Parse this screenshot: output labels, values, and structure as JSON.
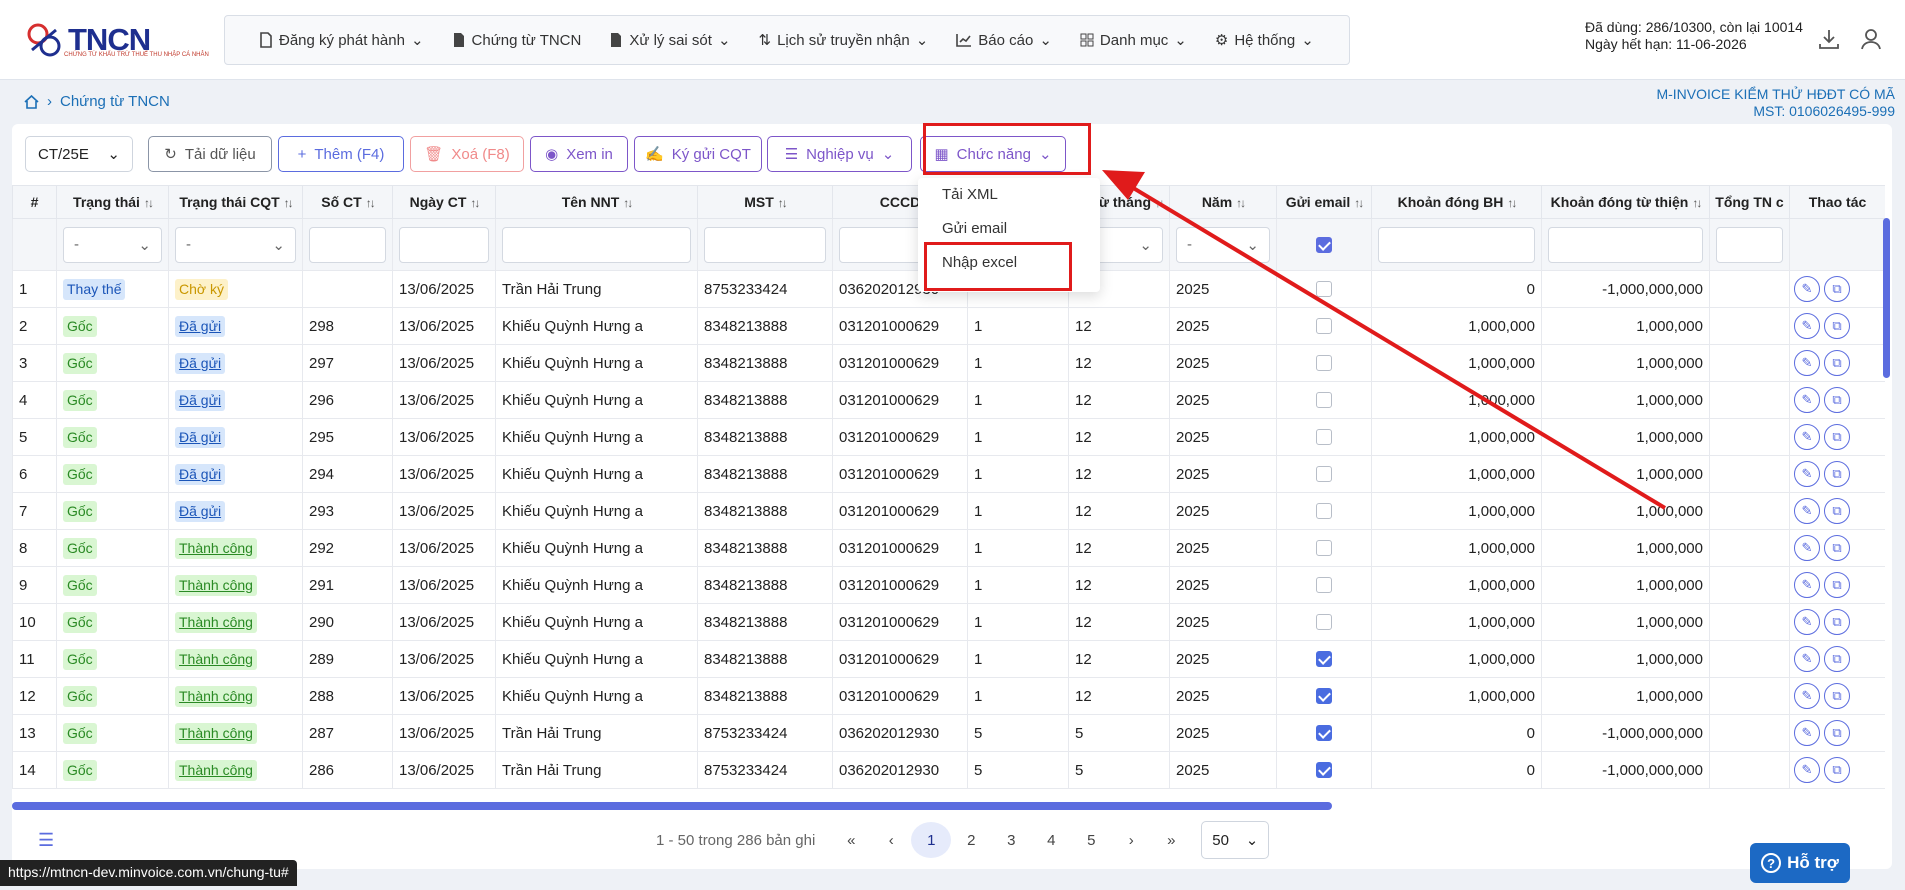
{
  "app": {
    "logo": "TNCN",
    "logo_sub": "CHỨNG TỪ KHẤU TRỪ THUẾ THU NHẬP CÁ NHÂN"
  },
  "nav": [
    "Đăng ký phát hành",
    "Chứng từ TNCN",
    "Xử lý sai sót",
    "Lịch sử truyền nhận",
    "Báo cáo",
    "Danh mục",
    "Hệ thống"
  ],
  "usage": {
    "line1": "Đã dùng: 286/10300, còn lại 10014",
    "line2": "Ngày hết hạn: 11-06-2026"
  },
  "breadcrumb": "Chứng từ TNCN",
  "company": {
    "name": "M-INVOICE KIỂM THỬ HĐĐT CÓ MÃ",
    "mst": "MST: 0106026495-999"
  },
  "toolbar": {
    "series": "CT/25E",
    "reload": "Tải dữ liệu",
    "add": "Thêm (F4)",
    "delete": "Xoá (F8)",
    "print": "Xem in",
    "sign": "Ký gửi CQT",
    "ops": "Nghiệp vụ",
    "functions": "Chức năng"
  },
  "menu": [
    "Tải XML",
    "Gửi email",
    "Nhập excel"
  ],
  "columns": [
    "#",
    "Trạng thái",
    "Trạng thái CQT",
    "Số CT",
    "Ngày CT",
    "Tên NNT",
    "MST",
    "CCCD",
    "",
    "Từ tháng",
    "Năm",
    "Gửi email",
    "Khoản đóng BH",
    "Khoản đóng từ thiện",
    "Tổng TN c",
    "Thao tác"
  ],
  "filter_dash": "-",
  "rows": [
    {
      "no": "1",
      "status": "Thay thế",
      "cqt": "Chờ ký",
      "so": "",
      "date": "13/06/2025",
      "name": "Trần Hải Trung",
      "mst": "8753233424",
      "cccd": "036202012930",
      "a": "",
      "b": "",
      "year": "2025",
      "email": false,
      "bh": "0",
      "tt": "-1,000,000,000"
    },
    {
      "no": "2",
      "status": "Gốc",
      "cqt": "Đã gửi",
      "so": "298",
      "date": "13/06/2025",
      "name": "Khiếu Quỳnh Hưng a",
      "mst": "8348213888",
      "cccd": "031201000629",
      "a": "1",
      "b": "12",
      "year": "2025",
      "email": false,
      "bh": "1,000,000",
      "tt": "1,000,000"
    },
    {
      "no": "3",
      "status": "Gốc",
      "cqt": "Đã gửi",
      "so": "297",
      "date": "13/06/2025",
      "name": "Khiếu Quỳnh Hưng a",
      "mst": "8348213888",
      "cccd": "031201000629",
      "a": "1",
      "b": "12",
      "year": "2025",
      "email": false,
      "bh": "1,000,000",
      "tt": "1,000,000"
    },
    {
      "no": "4",
      "status": "Gốc",
      "cqt": "Đã gửi",
      "so": "296",
      "date": "13/06/2025",
      "name": "Khiếu Quỳnh Hưng a",
      "mst": "8348213888",
      "cccd": "031201000629",
      "a": "1",
      "b": "12",
      "year": "2025",
      "email": false,
      "bh": "1,000,000",
      "tt": "1,000,000"
    },
    {
      "no": "5",
      "status": "Gốc",
      "cqt": "Đã gửi",
      "so": "295",
      "date": "13/06/2025",
      "name": "Khiếu Quỳnh Hưng a",
      "mst": "8348213888",
      "cccd": "031201000629",
      "a": "1",
      "b": "12",
      "year": "2025",
      "email": false,
      "bh": "1,000,000",
      "tt": "1,000,000"
    },
    {
      "no": "6",
      "status": "Gốc",
      "cqt": "Đã gửi",
      "so": "294",
      "date": "13/06/2025",
      "name": "Khiếu Quỳnh Hưng a",
      "mst": "8348213888",
      "cccd": "031201000629",
      "a": "1",
      "b": "12",
      "year": "2025",
      "email": false,
      "bh": "1,000,000",
      "tt": "1,000,000"
    },
    {
      "no": "7",
      "status": "Gốc",
      "cqt": "Đã gửi",
      "so": "293",
      "date": "13/06/2025",
      "name": "Khiếu Quỳnh Hưng a",
      "mst": "8348213888",
      "cccd": "031201000629",
      "a": "1",
      "b": "12",
      "year": "2025",
      "email": false,
      "bh": "1,000,000",
      "tt": "1,000,000"
    },
    {
      "no": "8",
      "status": "Gốc",
      "cqt": "Thành công",
      "so": "292",
      "date": "13/06/2025",
      "name": "Khiếu Quỳnh Hưng a",
      "mst": "8348213888",
      "cccd": "031201000629",
      "a": "1",
      "b": "12",
      "year": "2025",
      "email": false,
      "bh": "1,000,000",
      "tt": "1,000,000"
    },
    {
      "no": "9",
      "status": "Gốc",
      "cqt": "Thành công",
      "so": "291",
      "date": "13/06/2025",
      "name": "Khiếu Quỳnh Hưng a",
      "mst": "8348213888",
      "cccd": "031201000629",
      "a": "1",
      "b": "12",
      "year": "2025",
      "email": false,
      "bh": "1,000,000",
      "tt": "1,000,000"
    },
    {
      "no": "10",
      "status": "Gốc",
      "cqt": "Thành công",
      "so": "290",
      "date": "13/06/2025",
      "name": "Khiếu Quỳnh Hưng a",
      "mst": "8348213888",
      "cccd": "031201000629",
      "a": "1",
      "b": "12",
      "year": "2025",
      "email": false,
      "bh": "1,000,000",
      "tt": "1,000,000"
    },
    {
      "no": "11",
      "status": "Gốc",
      "cqt": "Thành công",
      "so": "289",
      "date": "13/06/2025",
      "name": "Khiếu Quỳnh Hưng a",
      "mst": "8348213888",
      "cccd": "031201000629",
      "a": "1",
      "b": "12",
      "year": "2025",
      "email": true,
      "bh": "1,000,000",
      "tt": "1,000,000"
    },
    {
      "no": "12",
      "status": "Gốc",
      "cqt": "Thành công",
      "so": "288",
      "date": "13/06/2025",
      "name": "Khiếu Quỳnh Hưng a",
      "mst": "8348213888",
      "cccd": "031201000629",
      "a": "1",
      "b": "12",
      "year": "2025",
      "email": true,
      "bh": "1,000,000",
      "tt": "1,000,000"
    },
    {
      "no": "13",
      "status": "Gốc",
      "cqt": "Thành công",
      "so": "287",
      "date": "13/06/2025",
      "name": "Trần Hải Trung",
      "mst": "8753233424",
      "cccd": "036202012930",
      "a": "5",
      "b": "5",
      "year": "2025",
      "email": true,
      "bh": "0",
      "tt": "-1,000,000,000"
    },
    {
      "no": "14",
      "status": "Gốc",
      "cqt": "Thành công",
      "so": "286",
      "date": "13/06/2025",
      "name": "Trần Hải Trung",
      "mst": "8753233424",
      "cccd": "036202012930",
      "a": "5",
      "b": "5",
      "year": "2025",
      "email": true,
      "bh": "0",
      "tt": "-1,000,000,000"
    }
  ],
  "pager": {
    "summary": "1 - 50 trong 286 bản ghi",
    "pages": [
      "1",
      "2",
      "3",
      "4",
      "5"
    ],
    "page_size": "50"
  },
  "help": "Hỗ trợ",
  "status_url": "https://mtncn-dev.minvoice.com.vn/chung-tu#",
  "colors": {
    "accent": "#5b6cdf",
    "brand": "#1e2f8f",
    "highlight": "#e01b1b"
  }
}
